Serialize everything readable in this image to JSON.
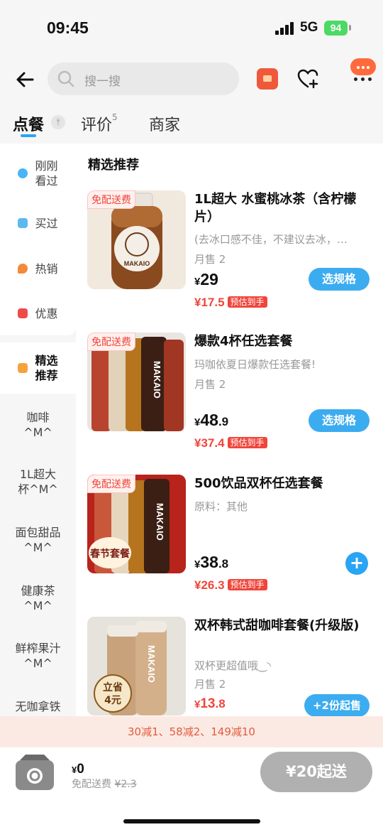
{
  "status_bar": {
    "time": "09:45",
    "network": "5G",
    "battery": "94"
  },
  "search": {
    "placeholder": "搜一搜"
  },
  "tabs": [
    {
      "label": "点餐"
    },
    {
      "label": "评价",
      "count": "5"
    },
    {
      "label": "商家"
    }
  ],
  "sidebar": {
    "items": [
      {
        "label": "刚刚\n看过",
        "icon": "eye-icon"
      },
      {
        "label": "买过",
        "icon": "bag-icon"
      },
      {
        "label": "热销",
        "icon": "fire-icon"
      },
      {
        "label": "优惠",
        "icon": "coupon-icon"
      },
      {
        "label": "精选\n推荐",
        "icon": "thumbs-up-icon"
      },
      {
        "label": "咖啡\n^M^"
      },
      {
        "label": "1L超大\n杯^M^"
      },
      {
        "label": "面包甜品\n^M^"
      },
      {
        "label": "健康茶\n^M^"
      },
      {
        "label": "鲜榨果汁\n^M^"
      },
      {
        "label": "无咖拿铁"
      }
    ]
  },
  "section": {
    "title": "精选推荐"
  },
  "badge_free_delivery": "免配送费",
  "brand_text": "MAKAIO",
  "products": [
    {
      "name": "1L超大 水蜜桃冰茶（含柠檬片）",
      "desc": "(去冰口感不佳，不建议去冰，…",
      "sales": "月售 2",
      "currency": "¥",
      "price_int": "29",
      "price_dec": "",
      "est_price": "¥17.5",
      "est_tag": "预估到手",
      "button": "选规格"
    },
    {
      "name": "爆款4杯任选套餐",
      "desc": "玛咖依夏日爆款任选套餐!",
      "sales": "月售 2",
      "currency": "¥",
      "price_int": "48",
      "price_dec": ".9",
      "est_price": "¥37.4",
      "est_tag": "预估到手",
      "button": "选规格"
    },
    {
      "name": "500饮品双杯任选套餐",
      "desc": "原料：其他",
      "currency": "¥",
      "price_int": "38",
      "price_dec": ".8",
      "est_price": "¥26.3",
      "est_tag": "预估到手",
      "button": "+",
      "sticker": "春节套餐"
    },
    {
      "name": "双杯韩式甜咖啡套餐(升级版)",
      "desc": "双杯更超值哦‿◝",
      "sales": "月售 2",
      "currency": "¥",
      "price_int": "13",
      "price_dec": ".8",
      "button": "+2份起售",
      "sticker": "立省\n4元"
    }
  ],
  "promo": "30减1、58减2、149减10",
  "cart": {
    "currency": "¥",
    "total": "0",
    "delivery_label": "免配送费",
    "delivery_original": "¥2.3",
    "submit": "¥20起送"
  },
  "colors": {
    "accent": "#2aa4f4",
    "price_red": "#f0453a",
    "promo_bg": "#fbeae3",
    "submit_disabled": "#b0b0b0"
  }
}
